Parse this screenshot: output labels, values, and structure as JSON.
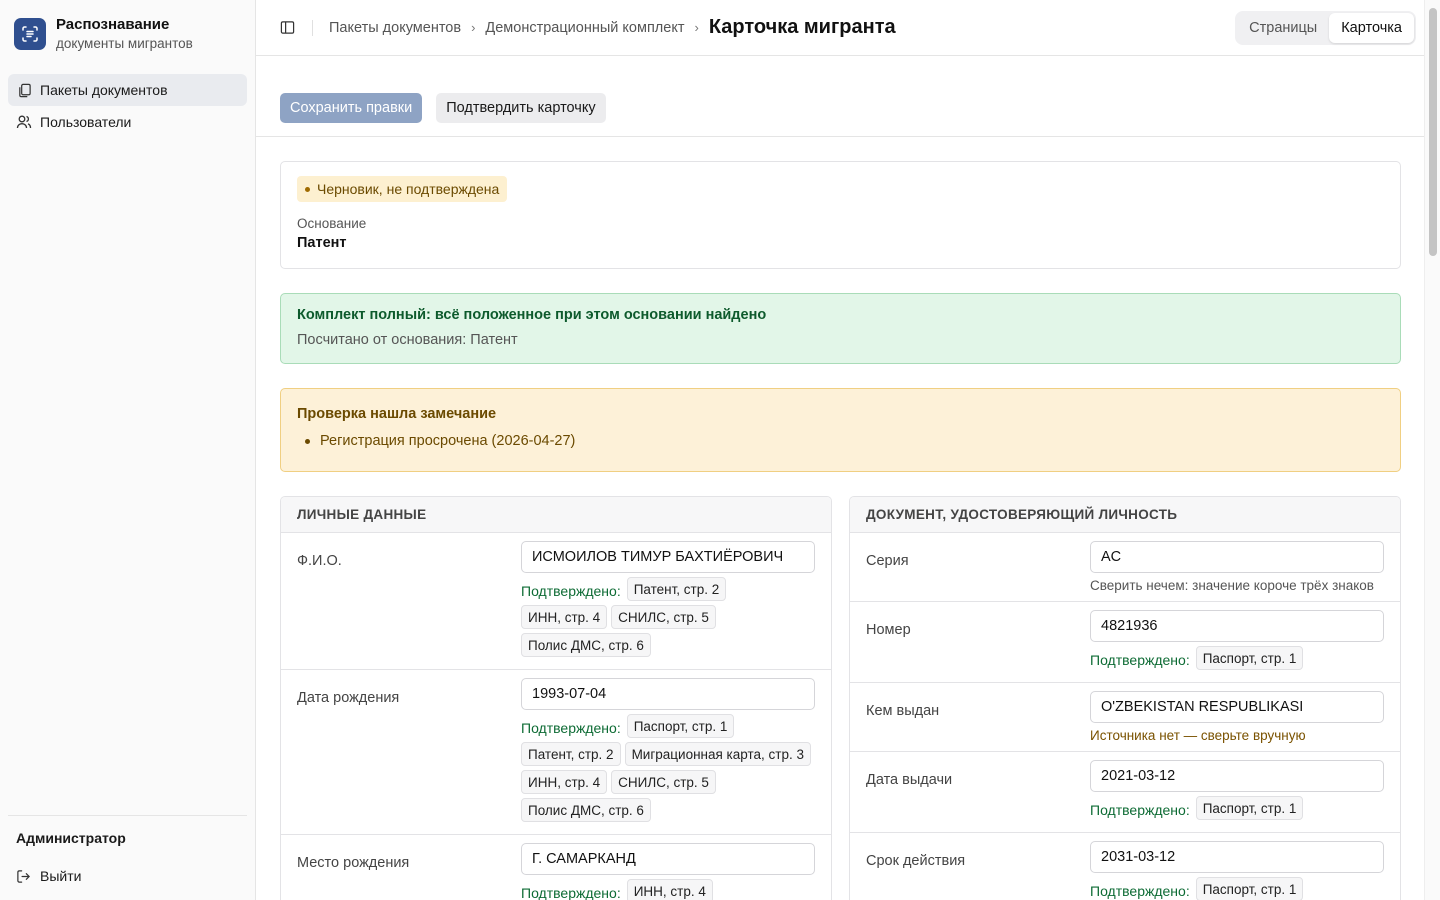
{
  "brand": {
    "title": "Распознавание",
    "subtitle": "документы мигрантов",
    "icon": "scan-document-icon"
  },
  "nav": {
    "items": [
      {
        "label": "Пакеты документов",
        "icon": "documents-icon",
        "active": true
      },
      {
        "label": "Пользователи",
        "icon": "users-icon",
        "active": false
      }
    ]
  },
  "footer": {
    "user": "Администратор",
    "logout": "Выйти"
  },
  "breadcrumb": {
    "items": [
      "Пакеты документов",
      "Демонстрационный комплект"
    ],
    "current": "Карточка мигранта"
  },
  "view_switch": {
    "options": [
      "Страницы",
      "Карточка"
    ],
    "selected": "Карточка"
  },
  "actions": {
    "save": "Сохранить правки",
    "confirm": "Подтвердить карточку"
  },
  "status": {
    "badge": "Черновик, не подтверждена",
    "basis_label": "Основание",
    "basis_value": "Патент"
  },
  "completeness": {
    "title": "Комплект полный: всё положенное при этом основании найдено",
    "subtitle": "Посчитано от основания: Патент"
  },
  "check": {
    "title": "Проверка нашла замечание",
    "items": [
      "Регистрация просрочена (2026-04-27)"
    ]
  },
  "personal": {
    "title": "ЛИЧНЫЕ ДАННЫЕ",
    "confirmed_label": "Подтверждено:",
    "rows": [
      {
        "label": "Ф.И.О.",
        "value": "ИСМОИЛОВ ТИМУР БАХТИЁРОВИЧ",
        "sources": [
          "Патент, стр. 2",
          "ИНН, стр. 4",
          "СНИЛС, стр. 5",
          "Полис ДМС, стр. 6"
        ]
      },
      {
        "label": "Дата рождения",
        "value": "1993-07-04",
        "sources": [
          "Паспорт, стр. 1",
          "Патент, стр. 2",
          "Миграционная карта, стр. 3",
          "ИНН, стр. 4",
          "СНИЛС, стр. 5",
          "Полис ДМС, стр. 6"
        ]
      },
      {
        "label": "Место рождения",
        "value": "Г. САМАРКАНД",
        "sources": [
          "ИНН, стр. 4"
        ]
      }
    ]
  },
  "identity": {
    "title": "ДОКУМЕНТ, УДОСТОВЕРЯЮЩИЙ ЛИЧНОСТЬ",
    "confirmed_label": "Подтверждено:",
    "rows": [
      {
        "label": "Серия",
        "value": "AC",
        "hint": "Сверить нечем: значение короче трёх знаков"
      },
      {
        "label": "Номер",
        "value": "4821936",
        "sources": [
          "Паспорт, стр. 1"
        ]
      },
      {
        "label": "Кем выдан",
        "value": "O'ZBEKISTAN RESPUBLIKASI",
        "warn": "Источника нет — сверьте вручную"
      },
      {
        "label": "Дата выдачи",
        "value": "2021-03-12",
        "sources": [
          "Паспорт, стр. 1"
        ]
      },
      {
        "label": "Срок действия",
        "value": "2031-03-12",
        "sources": [
          "Паспорт, стр. 1"
        ]
      }
    ]
  },
  "colors": {
    "accent": "#2f4f8f",
    "confirmed": "#0d6b34",
    "warning": "#6b4a00",
    "success_bg": "#e2f6e8"
  }
}
